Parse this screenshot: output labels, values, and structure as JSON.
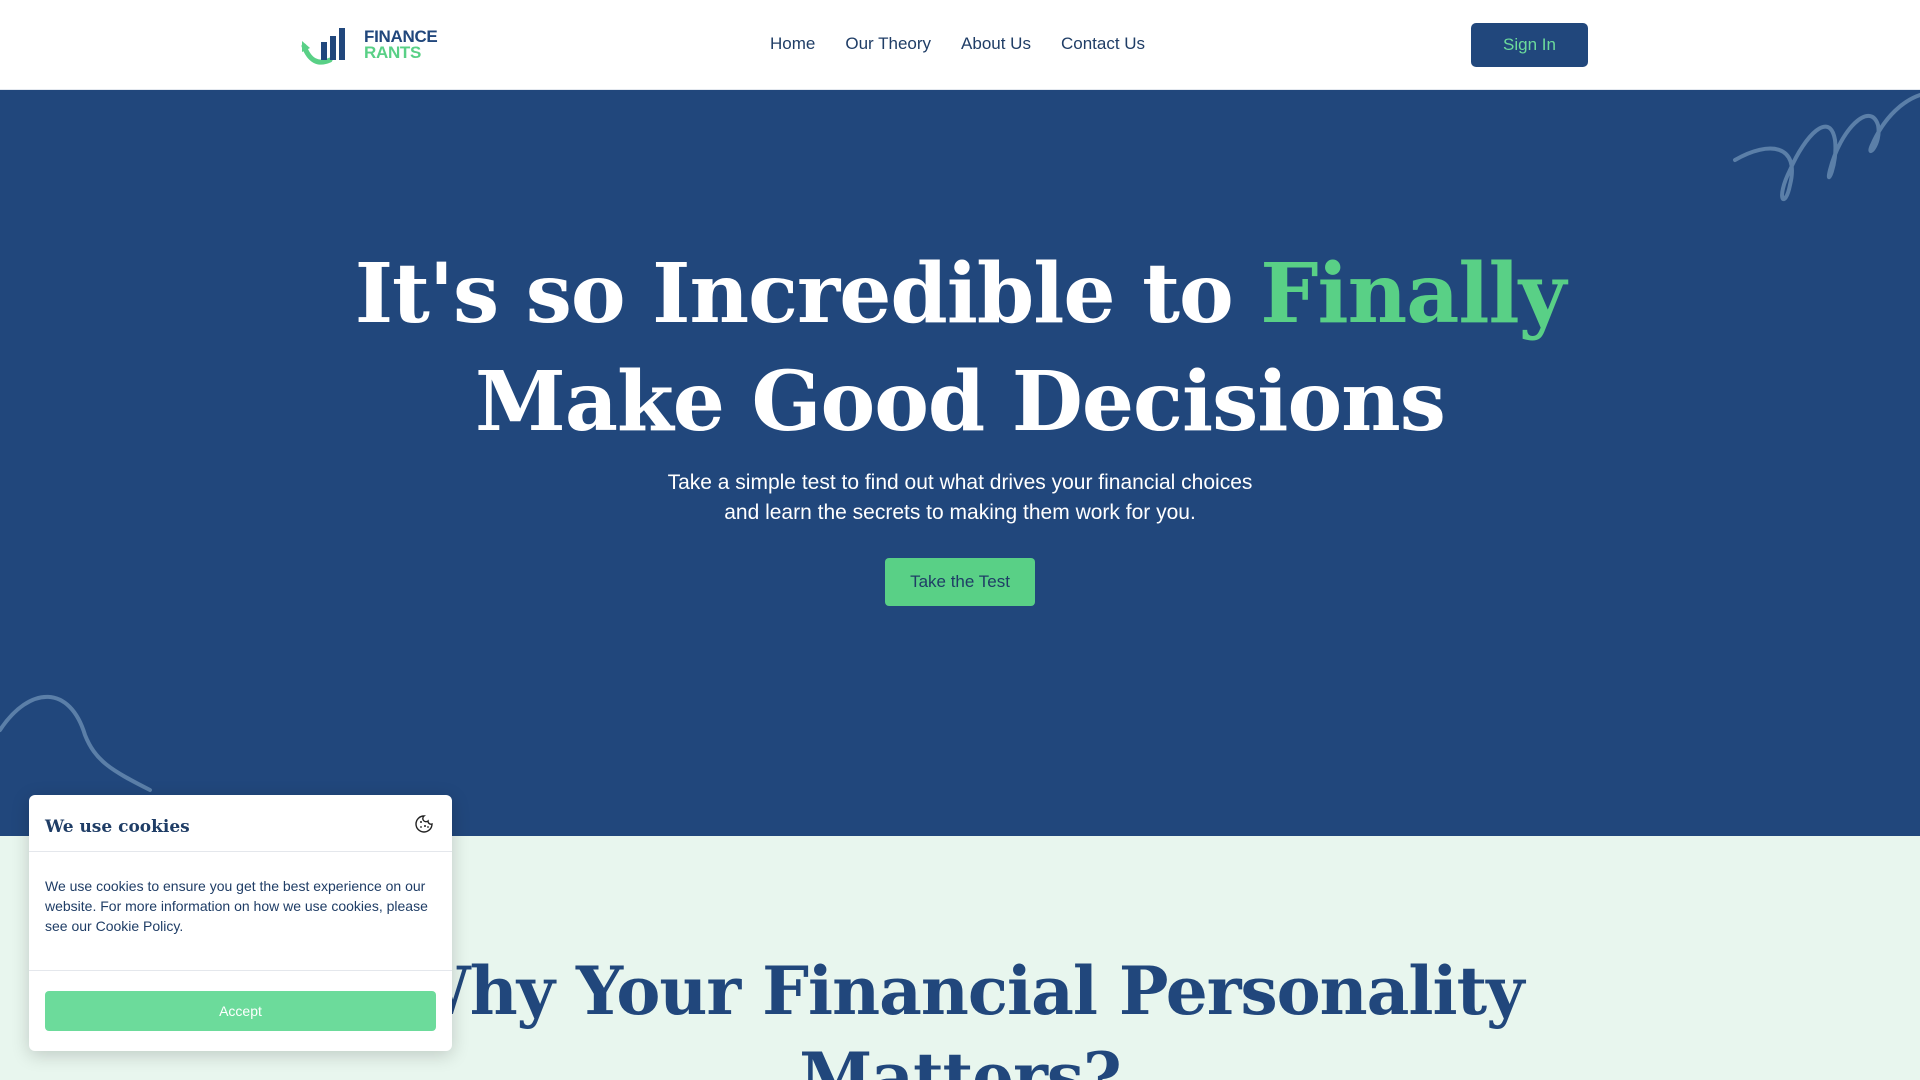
{
  "header": {
    "logo_line1": "FINANCE",
    "logo_line2": "RANTS",
    "nav": [
      "Home",
      "Our Theory",
      "About Us",
      "Contact Us"
    ],
    "signin_label": "Sign In"
  },
  "hero": {
    "title_part1": "It's so Incredible to ",
    "title_accent": "Finally",
    "title_line2": "Make Good Decisions",
    "subtitle_line1": "Take a simple test to find out what drives your financial choices",
    "subtitle_line2": "and learn the secrets to making them work for you.",
    "cta_label": "Take the Test"
  },
  "section2": {
    "title_line1": "Why Your Financial Personality",
    "title_line2": "Matters?"
  },
  "cookie": {
    "title": "We use cookies",
    "icon": "cookie-icon",
    "body": "We use cookies to ensure you get the best experience on our website. For more information on how we use cookies, please see our Cookie Policy.",
    "accept_label": "Accept"
  },
  "colors": {
    "navy": "#21477c",
    "green": "#59d086",
    "mint_bg": "#e8f6ee"
  }
}
